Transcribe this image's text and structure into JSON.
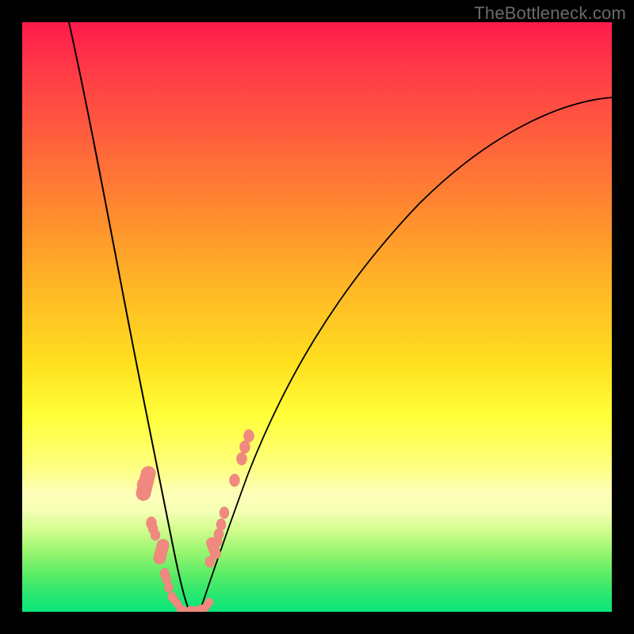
{
  "watermark": "TheBottleneck.com",
  "colors": {
    "background": "#000000",
    "watermark_text": "#6b6b6b",
    "curve": "#000000",
    "marker_fill": "#f08a81",
    "marker_stroke": "#ef7a70",
    "gradient_stops": [
      "#ff1a4b",
      "#ff5a3e",
      "#ff8a2f",
      "#ffe01f",
      "#ffff3a",
      "#feffb9",
      "#96f56e",
      "#0be57b"
    ]
  },
  "chart_data": {
    "type": "line",
    "title": "",
    "xlabel": "",
    "ylabel": "",
    "xlim": [
      0,
      100
    ],
    "ylim": [
      0,
      100
    ],
    "legend": false,
    "grid": false,
    "series": [
      {
        "name": "left-branch",
        "x": [
          8,
          10,
          12,
          14,
          16,
          18,
          20,
          22,
          23,
          24,
          25,
          26,
          27
        ],
        "y": [
          100,
          80,
          63,
          50,
          39,
          30,
          22,
          14,
          10,
          7,
          4,
          2,
          0
        ]
      },
      {
        "name": "right-branch",
        "x": [
          29,
          30,
          31,
          33,
          36,
          40,
          46,
          55,
          66,
          80,
          100
        ],
        "y": [
          0,
          2,
          6,
          13,
          23,
          36,
          50,
          63,
          73,
          81,
          87
        ]
      }
    ],
    "markers_left": [
      {
        "x": 20.3,
        "y": 21.5
      },
      {
        "x": 20.6,
        "y": 20.0
      },
      {
        "x": 21.8,
        "y": 15.0
      },
      {
        "x": 22.1,
        "y": 14.1
      },
      {
        "x": 22.4,
        "y": 13.0
      },
      {
        "x": 23.3,
        "y": 9.0
      },
      {
        "x": 24.1,
        "y": 6.5
      },
      {
        "x": 24.4,
        "y": 5.5
      },
      {
        "x": 24.8,
        "y": 4.2
      },
      {
        "x": 25.4,
        "y": 2.6
      },
      {
        "x": 25.7,
        "y": 2.0
      },
      {
        "x": 26.2,
        "y": 1.3
      }
    ],
    "markers_right": [
      {
        "x": 31.7,
        "y": 8.5
      },
      {
        "x": 32.9,
        "y": 12.0
      },
      {
        "x": 33.2,
        "y": 13.2
      },
      {
        "x": 33.6,
        "y": 14.8
      },
      {
        "x": 34.1,
        "y": 16.8
      },
      {
        "x": 35.8,
        "y": 22.4
      },
      {
        "x": 37.0,
        "y": 26.0
      },
      {
        "x": 37.6,
        "y": 27.9
      },
      {
        "x": 38.2,
        "y": 29.8
      }
    ],
    "markers_bottom": [
      {
        "x": 26.8,
        "y": 0.6
      },
      {
        "x": 27.2,
        "y": 0.5
      },
      {
        "x": 28.5,
        "y": 0.4
      },
      {
        "x": 29.7,
        "y": 0.4
      },
      {
        "x": 30.1,
        "y": 0.5
      },
      {
        "x": 30.8,
        "y": 0.7
      },
      {
        "x": 31.2,
        "y": 1.1
      },
      {
        "x": 31.6,
        "y": 1.6
      }
    ],
    "pill_markers_left": [
      {
        "x1": 20.0,
        "y1": 23.0,
        "x2": 21.2,
        "y2": 18.0
      },
      {
        "x1": 22.9,
        "y1": 11.0,
        "x2": 23.6,
        "y2": 8.5
      }
    ],
    "pill_markers_right": [
      {
        "x1": 32.2,
        "y1": 9.8,
        "x2": 32.8,
        "y2": 11.8
      }
    ]
  }
}
